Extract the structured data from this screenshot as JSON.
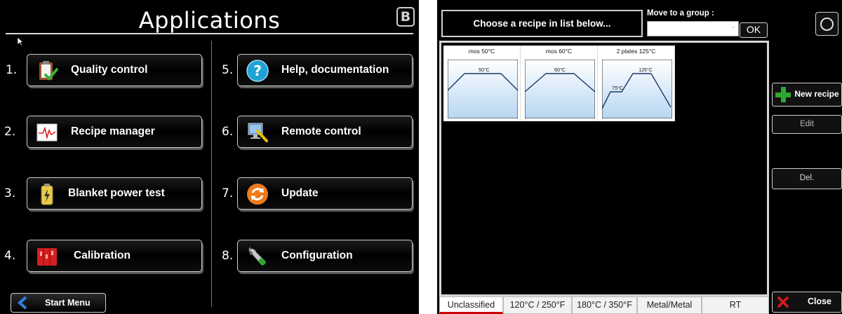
{
  "applications": {
    "title": "Applications",
    "badge": "B",
    "items": [
      {
        "number": "1.",
        "label": "Quality control",
        "icon": "clipboard-check-icon"
      },
      {
        "number": "2.",
        "label": "Recipe manager",
        "icon": "graph-icon"
      },
      {
        "number": "3.",
        "label": "Blanket power test",
        "icon": "battery-icon"
      },
      {
        "number": "4.",
        "label": "Calibration",
        "icon": "calibration-icon"
      },
      {
        "number": "5.",
        "label": "Help, documentation",
        "icon": "help-icon"
      },
      {
        "number": "6.",
        "label": "Remote control",
        "icon": "remote-computer-icon"
      },
      {
        "number": "7.",
        "label": "Update",
        "icon": "update-icon"
      },
      {
        "number": "8.",
        "label": "Configuration",
        "icon": "wrench-icon"
      }
    ],
    "start_menu": "Start Menu"
  },
  "recipes": {
    "header": "Choose a recipe in list below...",
    "group_label": "Move to a group :",
    "group_value": "",
    "ok": "OK",
    "cards": [
      {
        "name": "mos 50°C",
        "temps": [
          "50°C"
        ]
      },
      {
        "name": "mos 60°C",
        "temps": [
          "60°C"
        ]
      },
      {
        "name": "2 plates 125°C",
        "temps": [
          "75°C",
          "125°C"
        ]
      }
    ],
    "tabs": [
      "Unclassified",
      "120°C / 250°F",
      "180°C / 350°F",
      "Metal/Metal",
      "RT"
    ],
    "active_tab": "Unclassified",
    "buttons": {
      "new": "New recipe",
      "edit": "Edit",
      "del": "Del.",
      "close": "Close"
    }
  },
  "colors": {
    "background": "#000000",
    "border": "#cfcfcf",
    "active_tab_accent": "#cc0000",
    "plus_green": "#2ea82e",
    "close_red": "#cc1111"
  }
}
